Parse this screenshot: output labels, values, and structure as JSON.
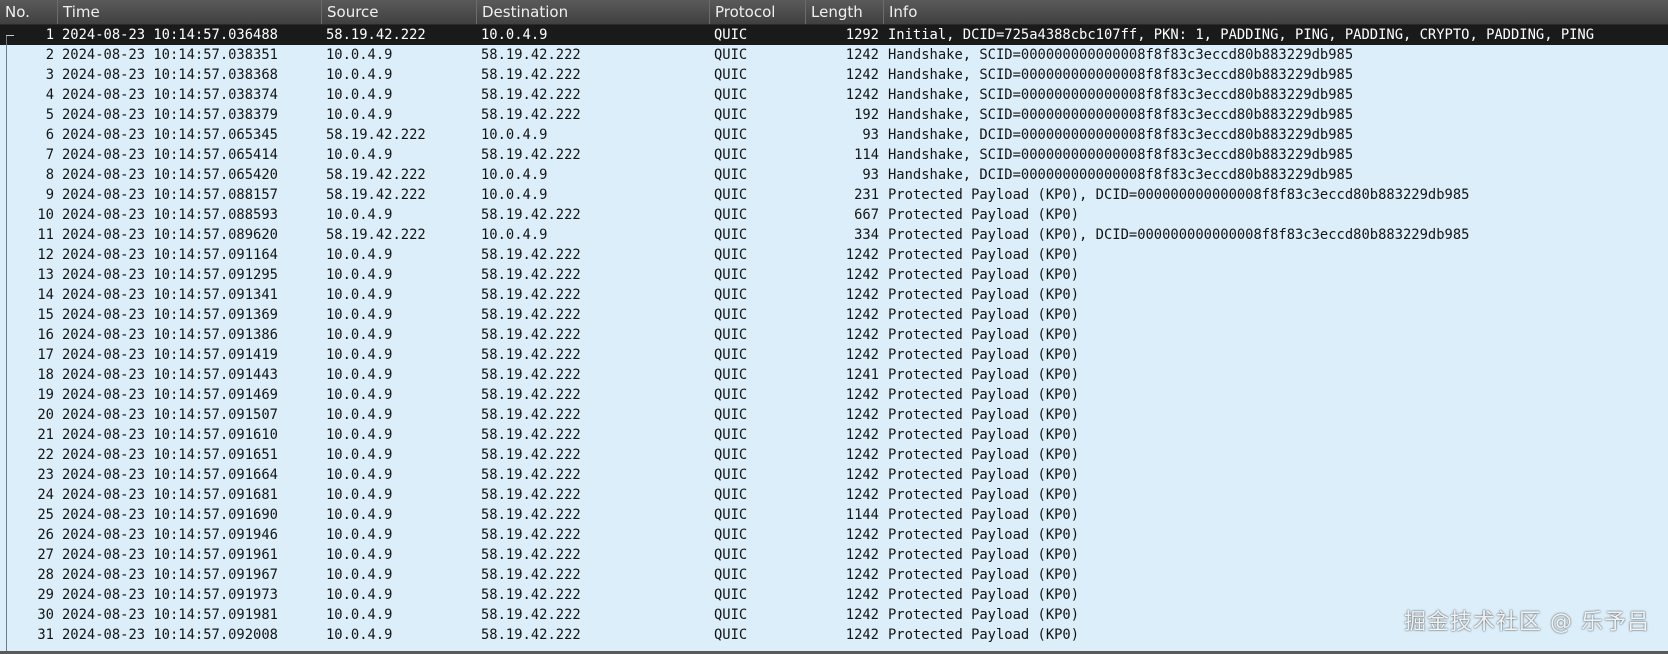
{
  "columns": {
    "no": "No.",
    "time": "Time",
    "source": "Source",
    "destination": "Destination",
    "protocol": "Protocol",
    "length": "Length",
    "info": "Info"
  },
  "packets": [
    {
      "no": "1",
      "time": "2024-08-23 10:14:57.036488",
      "src": "58.19.42.222",
      "dst": "10.0.4.9",
      "proto": "QUIC",
      "len": "1292",
      "info": "Initial, DCID=725a4388cbc107ff, PKN: 1, PADDING, PING, PADDING, CRYPTO, PADDING, PING"
    },
    {
      "no": "2",
      "time": "2024-08-23 10:14:57.038351",
      "src": "10.0.4.9",
      "dst": "58.19.42.222",
      "proto": "QUIC",
      "len": "1242",
      "info": "Handshake, SCID=000000000000008f8f83c3eccd80b883229db985"
    },
    {
      "no": "3",
      "time": "2024-08-23 10:14:57.038368",
      "src": "10.0.4.9",
      "dst": "58.19.42.222",
      "proto": "QUIC",
      "len": "1242",
      "info": "Handshake, SCID=000000000000008f8f83c3eccd80b883229db985"
    },
    {
      "no": "4",
      "time": "2024-08-23 10:14:57.038374",
      "src": "10.0.4.9",
      "dst": "58.19.42.222",
      "proto": "QUIC",
      "len": "1242",
      "info": "Handshake, SCID=000000000000008f8f83c3eccd80b883229db985"
    },
    {
      "no": "5",
      "time": "2024-08-23 10:14:57.038379",
      "src": "10.0.4.9",
      "dst": "58.19.42.222",
      "proto": "QUIC",
      "len": "192",
      "info": "Handshake, SCID=000000000000008f8f83c3eccd80b883229db985"
    },
    {
      "no": "6",
      "time": "2024-08-23 10:14:57.065345",
      "src": "58.19.42.222",
      "dst": "10.0.4.9",
      "proto": "QUIC",
      "len": "93",
      "info": "Handshake, DCID=000000000000008f8f83c3eccd80b883229db985"
    },
    {
      "no": "7",
      "time": "2024-08-23 10:14:57.065414",
      "src": "10.0.4.9",
      "dst": "58.19.42.222",
      "proto": "QUIC",
      "len": "114",
      "info": "Handshake, SCID=000000000000008f8f83c3eccd80b883229db985"
    },
    {
      "no": "8",
      "time": "2024-08-23 10:14:57.065420",
      "src": "58.19.42.222",
      "dst": "10.0.4.9",
      "proto": "QUIC",
      "len": "93",
      "info": "Handshake, DCID=000000000000008f8f83c3eccd80b883229db985"
    },
    {
      "no": "9",
      "time": "2024-08-23 10:14:57.088157",
      "src": "58.19.42.222",
      "dst": "10.0.4.9",
      "proto": "QUIC",
      "len": "231",
      "info": "Protected Payload (KP0), DCID=000000000000008f8f83c3eccd80b883229db985"
    },
    {
      "no": "10",
      "time": "2024-08-23 10:14:57.088593",
      "src": "10.0.4.9",
      "dst": "58.19.42.222",
      "proto": "QUIC",
      "len": "667",
      "info": "Protected Payload (KP0)"
    },
    {
      "no": "11",
      "time": "2024-08-23 10:14:57.089620",
      "src": "58.19.42.222",
      "dst": "10.0.4.9",
      "proto": "QUIC",
      "len": "334",
      "info": "Protected Payload (KP0), DCID=000000000000008f8f83c3eccd80b883229db985"
    },
    {
      "no": "12",
      "time": "2024-08-23 10:14:57.091164",
      "src": "10.0.4.9",
      "dst": "58.19.42.222",
      "proto": "QUIC",
      "len": "1242",
      "info": "Protected Payload (KP0)"
    },
    {
      "no": "13",
      "time": "2024-08-23 10:14:57.091295",
      "src": "10.0.4.9",
      "dst": "58.19.42.222",
      "proto": "QUIC",
      "len": "1242",
      "info": "Protected Payload (KP0)"
    },
    {
      "no": "14",
      "time": "2024-08-23 10:14:57.091341",
      "src": "10.0.4.9",
      "dst": "58.19.42.222",
      "proto": "QUIC",
      "len": "1242",
      "info": "Protected Payload (KP0)"
    },
    {
      "no": "15",
      "time": "2024-08-23 10:14:57.091369",
      "src": "10.0.4.9",
      "dst": "58.19.42.222",
      "proto": "QUIC",
      "len": "1242",
      "info": "Protected Payload (KP0)"
    },
    {
      "no": "16",
      "time": "2024-08-23 10:14:57.091386",
      "src": "10.0.4.9",
      "dst": "58.19.42.222",
      "proto": "QUIC",
      "len": "1242",
      "info": "Protected Payload (KP0)"
    },
    {
      "no": "17",
      "time": "2024-08-23 10:14:57.091419",
      "src": "10.0.4.9",
      "dst": "58.19.42.222",
      "proto": "QUIC",
      "len": "1242",
      "info": "Protected Payload (KP0)"
    },
    {
      "no": "18",
      "time": "2024-08-23 10:14:57.091443",
      "src": "10.0.4.9",
      "dst": "58.19.42.222",
      "proto": "QUIC",
      "len": "1241",
      "info": "Protected Payload (KP0)"
    },
    {
      "no": "19",
      "time": "2024-08-23 10:14:57.091469",
      "src": "10.0.4.9",
      "dst": "58.19.42.222",
      "proto": "QUIC",
      "len": "1242",
      "info": "Protected Payload (KP0)"
    },
    {
      "no": "20",
      "time": "2024-08-23 10:14:57.091507",
      "src": "10.0.4.9",
      "dst": "58.19.42.222",
      "proto": "QUIC",
      "len": "1242",
      "info": "Protected Payload (KP0)"
    },
    {
      "no": "21",
      "time": "2024-08-23 10:14:57.091610",
      "src": "10.0.4.9",
      "dst": "58.19.42.222",
      "proto": "QUIC",
      "len": "1242",
      "info": "Protected Payload (KP0)"
    },
    {
      "no": "22",
      "time": "2024-08-23 10:14:57.091651",
      "src": "10.0.4.9",
      "dst": "58.19.42.222",
      "proto": "QUIC",
      "len": "1242",
      "info": "Protected Payload (KP0)"
    },
    {
      "no": "23",
      "time": "2024-08-23 10:14:57.091664",
      "src": "10.0.4.9",
      "dst": "58.19.42.222",
      "proto": "QUIC",
      "len": "1242",
      "info": "Protected Payload (KP0)"
    },
    {
      "no": "24",
      "time": "2024-08-23 10:14:57.091681",
      "src": "10.0.4.9",
      "dst": "58.19.42.222",
      "proto": "QUIC",
      "len": "1242",
      "info": "Protected Payload (KP0)"
    },
    {
      "no": "25",
      "time": "2024-08-23 10:14:57.091690",
      "src": "10.0.4.9",
      "dst": "58.19.42.222",
      "proto": "QUIC",
      "len": "1144",
      "info": "Protected Payload (KP0)"
    },
    {
      "no": "26",
      "time": "2024-08-23 10:14:57.091946",
      "src": "10.0.4.9",
      "dst": "58.19.42.222",
      "proto": "QUIC",
      "len": "1242",
      "info": "Protected Payload (KP0)"
    },
    {
      "no": "27",
      "time": "2024-08-23 10:14:57.091961",
      "src": "10.0.4.9",
      "dst": "58.19.42.222",
      "proto": "QUIC",
      "len": "1242",
      "info": "Protected Payload (KP0)"
    },
    {
      "no": "28",
      "time": "2024-08-23 10:14:57.091967",
      "src": "10.0.4.9",
      "dst": "58.19.42.222",
      "proto": "QUIC",
      "len": "1242",
      "info": "Protected Payload (KP0)"
    },
    {
      "no": "29",
      "time": "2024-08-23 10:14:57.091973",
      "src": "10.0.4.9",
      "dst": "58.19.42.222",
      "proto": "QUIC",
      "len": "1242",
      "info": "Protected Payload (KP0)"
    },
    {
      "no": "30",
      "time": "2024-08-23 10:14:57.091981",
      "src": "10.0.4.9",
      "dst": "58.19.42.222",
      "proto": "QUIC",
      "len": "1242",
      "info": "Protected Payload (KP0)"
    },
    {
      "no": "31",
      "time": "2024-08-23 10:14:57.092008",
      "src": "10.0.4.9",
      "dst": "58.19.42.222",
      "proto": "QUIC",
      "len": "1242",
      "info": "Protected Payload (KP0)"
    }
  ],
  "selected_packet": "1",
  "watermark": "掘金技术社区 @ 乐予吕",
  "colors": {
    "row_background": "#dbeefa",
    "selected_background": "#1a1a1a",
    "header_background": "#4a4a4a"
  }
}
